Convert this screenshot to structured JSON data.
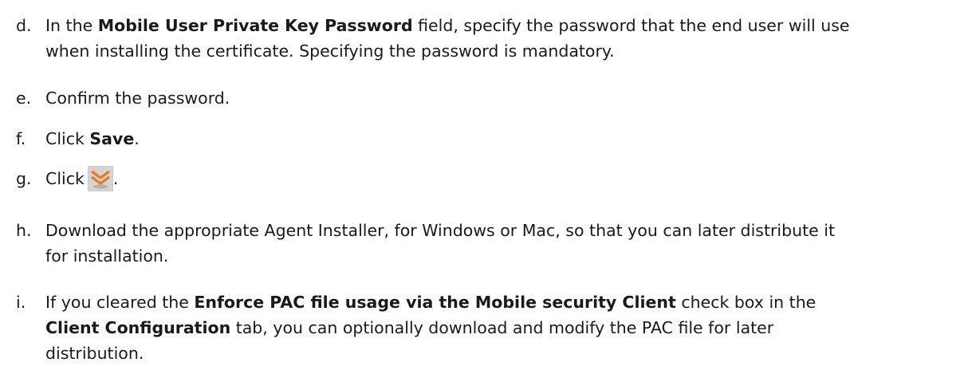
{
  "steps": {
    "d": {
      "letter": "d.",
      "l1_a": "In the ",
      "l1_b": "Mobile User Private Key Password",
      "l1_c": " field, specify the password that the end user will use",
      "l2": "when installing the certificate. Specifying the password is mandatory."
    },
    "e": {
      "letter": "e.",
      "text": "Confirm the password."
    },
    "f": {
      "letter": "f.",
      "a": "Click ",
      "b": "Save",
      "c": "."
    },
    "g": {
      "letter": "g.",
      "a": "Click",
      "c": ".",
      "icon": "download-chevron-icon"
    },
    "h": {
      "letter": "h.",
      "l1": "Download the appropriate Agent Installer, for Windows or Mac, so that you can later distribute it",
      "l2": "for installation."
    },
    "i": {
      "letter": "i.",
      "l1_a": "If you cleared the ",
      "l1_b": "Enforce PAC file usage via the Mobile security Client",
      "l1_c": " check box in the",
      "l2_b": "Client Configuration",
      "l2_c": " tab, you can optionally download and modify the PAC file for later",
      "l3": "distribution."
    }
  },
  "colors": {
    "text": "#1a1a1a",
    "icon_orange": "#e8791e",
    "icon_bg": "#c9c9c9"
  }
}
